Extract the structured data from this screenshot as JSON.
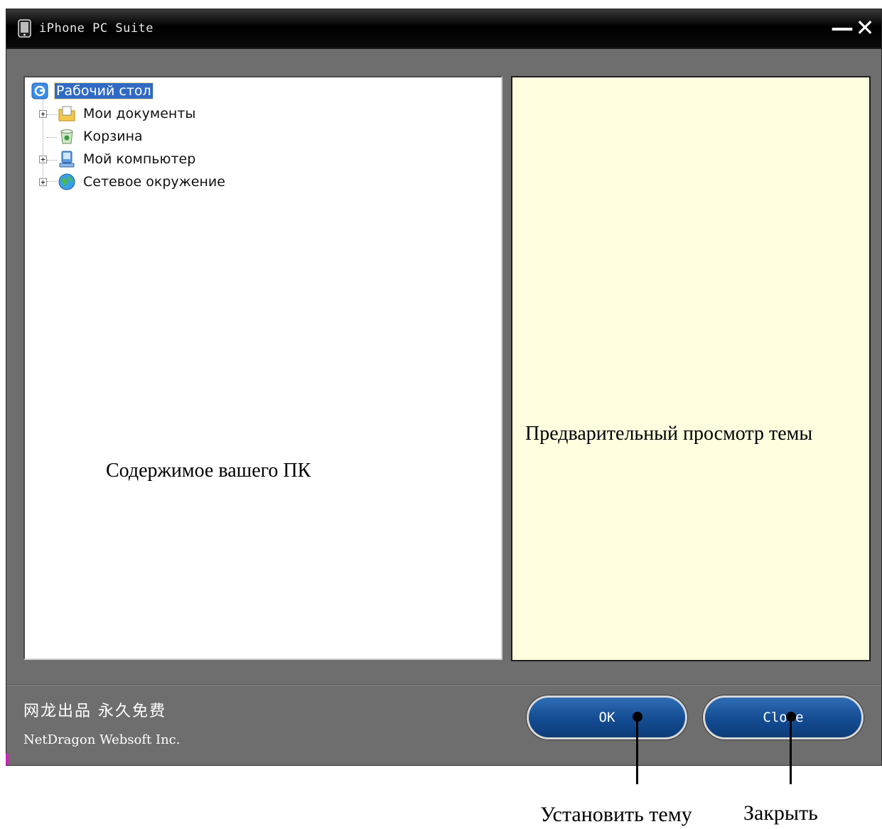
{
  "window": {
    "title": "iPhone PC Suite",
    "minimize_glyph": "—",
    "close_glyph": "✕"
  },
  "tree": {
    "items": [
      {
        "label": "Рабочий стол",
        "icon": "desktop-icon",
        "selected": true
      },
      {
        "label": "Мои документы",
        "icon": "my-documents-icon",
        "expandable": true
      },
      {
        "label": "Корзина",
        "icon": "recycle-bin-icon",
        "expandable": false
      },
      {
        "label": "Мой компьютер",
        "icon": "my-computer-icon",
        "expandable": true
      },
      {
        "label": "Сетевое окружение",
        "icon": "network-places-icon",
        "expandable": true
      }
    ],
    "caption": "Содержимое вашего ПК"
  },
  "preview": {
    "caption": "Предварительный просмотр темы"
  },
  "footer": {
    "chinese_text": "网龙出品  永久免费",
    "company": "NetDragon Websoft Inc.",
    "ok_label": "OK",
    "close_label": "Close"
  },
  "annotations": {
    "ok": "Установить тему",
    "close": "Закрыть"
  },
  "colors": {
    "window_bg": "#6e6e6e",
    "preview_bg": "#ffffe0",
    "selection": "#316ac5",
    "button_blue": "#134c92"
  }
}
